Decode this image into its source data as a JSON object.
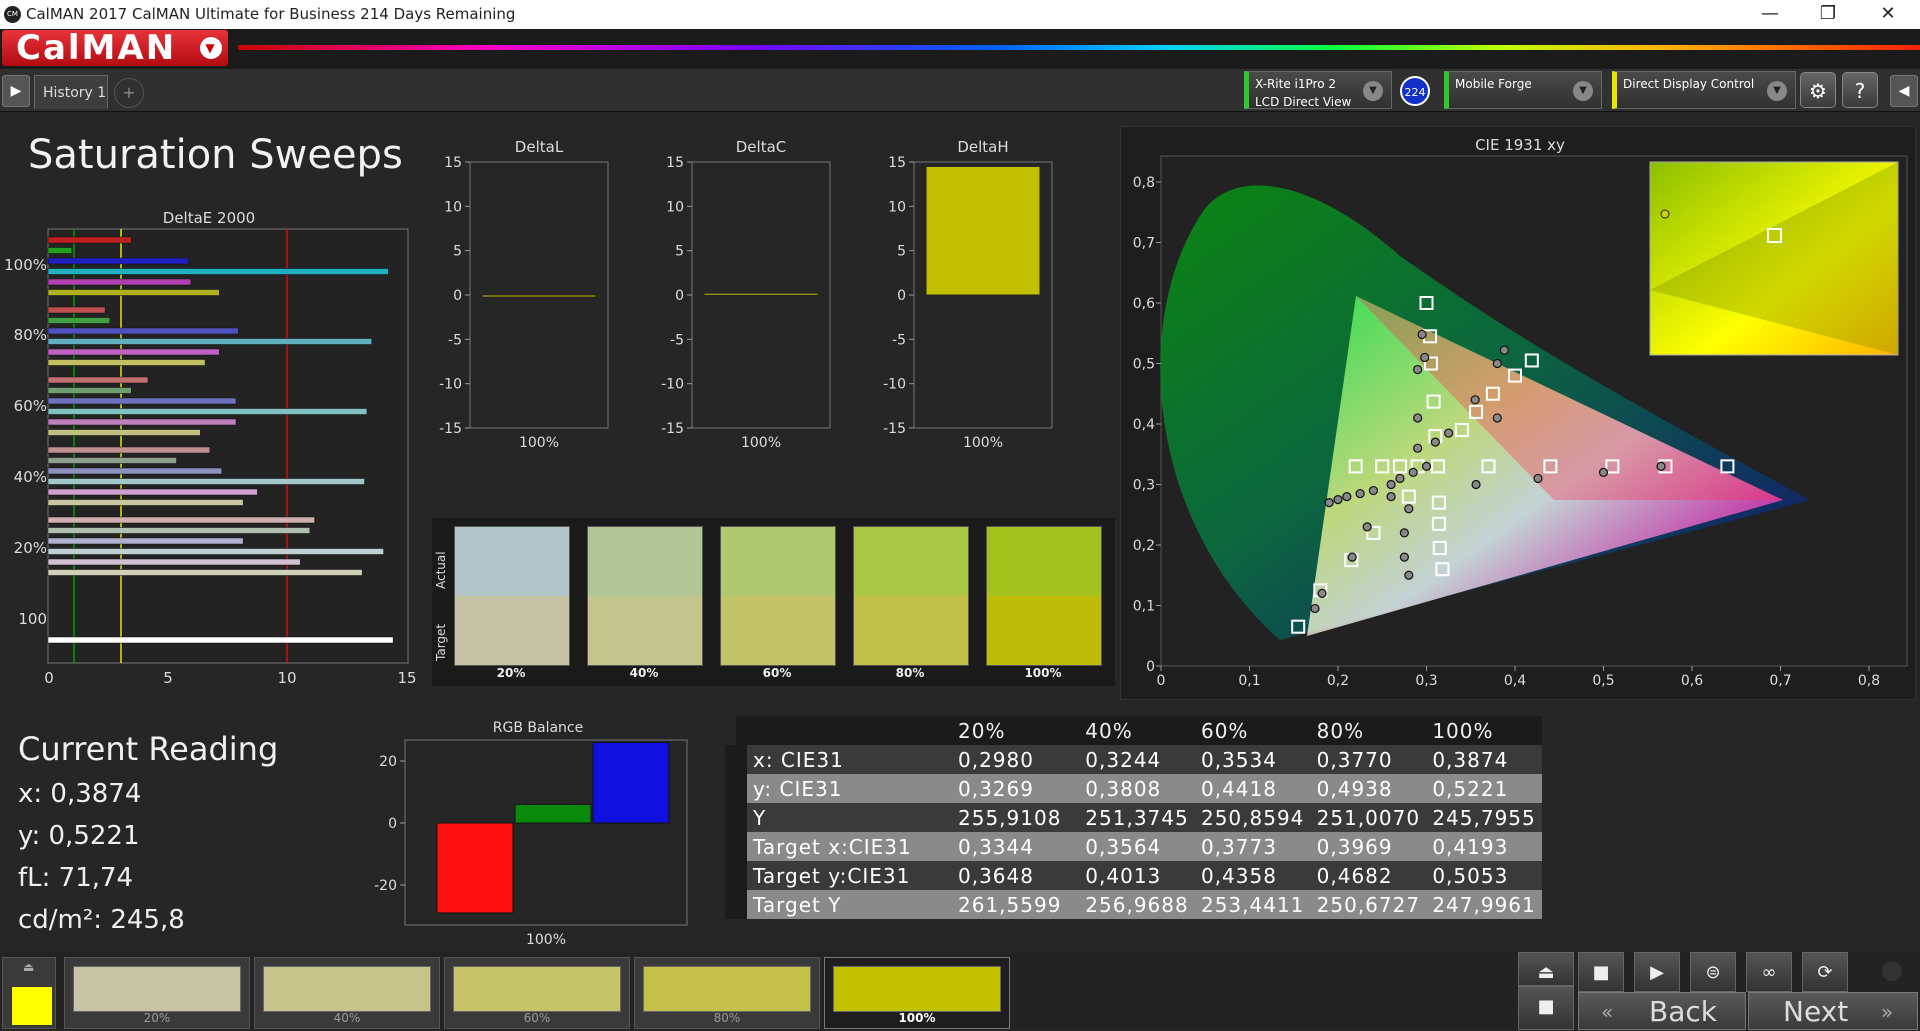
{
  "window": {
    "title": "CalMAN 2017 CalMAN Ultimate for Business 214 Days Remaining",
    "icon": "CM"
  },
  "logo": "CalMAN",
  "tabs": {
    "history_label": "History 1"
  },
  "devices": {
    "meter_name": "X-Rite i1Pro 2",
    "meter_mode": "LCD Direct View",
    "meter_badge": "224",
    "source": "Mobile Forge",
    "display": "Direct Display Control"
  },
  "page": {
    "title": "Saturation Sweeps"
  },
  "deltae": {
    "title": "DeltaE 2000",
    "y_labels": [
      "100%",
      "80%",
      "60%",
      "40%",
      "20%",
      "100"
    ],
    "x_ticks": [
      "0",
      "5",
      "10",
      "15"
    ]
  },
  "delta_charts": [
    {
      "title": "DeltaL",
      "xlabel": "100%",
      "value": -0.2
    },
    {
      "title": "DeltaC",
      "xlabel": "100%",
      "value": 0.2
    },
    {
      "title": "DeltaH",
      "xlabel": "100%",
      "value": 14.5
    }
  ],
  "delta_yticks": [
    "15",
    "10",
    "5",
    "0",
    "-5",
    "-10",
    "-15"
  ],
  "swatches": {
    "actual_label": "Actual",
    "target_label": "Target",
    "items": [
      {
        "label": "20%",
        "actual": "#b3c4c8",
        "target": "#c4c3a3"
      },
      {
        "label": "40%",
        "actual": "#b2c596",
        "target": "#c3c58c"
      },
      {
        "label": "60%",
        "actual": "#b0c870",
        "target": "#c3c369"
      },
      {
        "label": "80%",
        "actual": "#aac645",
        "target": "#c1c04b"
      },
      {
        "label": "100%",
        "actual": "#a3c21e",
        "target": "#bebc09"
      }
    ]
  },
  "cie": {
    "title": "CIE 1931 xy",
    "x_ticks": [
      "0",
      "0,1",
      "0,2",
      "0,3",
      "0,4",
      "0,5",
      "0,6",
      "0,7",
      "0,8"
    ],
    "y_ticks": [
      "0,8",
      "0,7",
      "0,6",
      "0,5",
      "0,4",
      "0,3",
      "0,2",
      "0,1",
      "0"
    ]
  },
  "rgb_balance": {
    "title": "RGB Balance",
    "xlabel": "100%",
    "yticks": [
      "20",
      "0",
      "-20"
    ],
    "red": -29,
    "green": 6,
    "blue": 26
  },
  "current_reading": {
    "title": "Current Reading",
    "x": "x: 0,3874",
    "y": "y: 0,5221",
    "fl": "fL: 71,74",
    "cdm2": "cd/m²: 245,8"
  },
  "table": {
    "headers": [
      "",
      "20%",
      "40%",
      "60%",
      "80%",
      "100%"
    ],
    "rows": [
      {
        "label": "x: CIE31",
        "values": [
          "0,2980",
          "0,3244",
          "0,3534",
          "0,3770",
          "0,3874"
        ]
      },
      {
        "label": "y: CIE31",
        "values": [
          "0,3269",
          "0,3808",
          "0,4418",
          "0,4938",
          "0,5221"
        ]
      },
      {
        "label": "Y",
        "values": [
          "255,9108",
          "251,3745",
          "250,8594",
          "251,0070",
          "245,7955"
        ]
      },
      {
        "label": "Target x:CIE31",
        "values": [
          "0,3344",
          "0,3564",
          "0,3773",
          "0,3969",
          "0,4193"
        ]
      },
      {
        "label": "Target y:CIE31",
        "values": [
          "0,3648",
          "0,4013",
          "0,4358",
          "0,4682",
          "0,5053"
        ]
      },
      {
        "label": "Target Y",
        "values": [
          "261,5599",
          "256,9688",
          "253,4411",
          "250,6727",
          "247,9961"
        ]
      }
    ]
  },
  "bottom": {
    "selected_color": "#ffff00",
    "swatches": [
      {
        "label": "20%",
        "color": "#c6c4a2"
      },
      {
        "label": "40%",
        "color": "#c6c48a"
      },
      {
        "label": "60%",
        "color": "#c5c468"
      },
      {
        "label": "80%",
        "color": "#c4c24a"
      },
      {
        "label": "100%",
        "color": "#c3c100"
      }
    ],
    "back_label": "Back",
    "next_label": "Next"
  }
}
